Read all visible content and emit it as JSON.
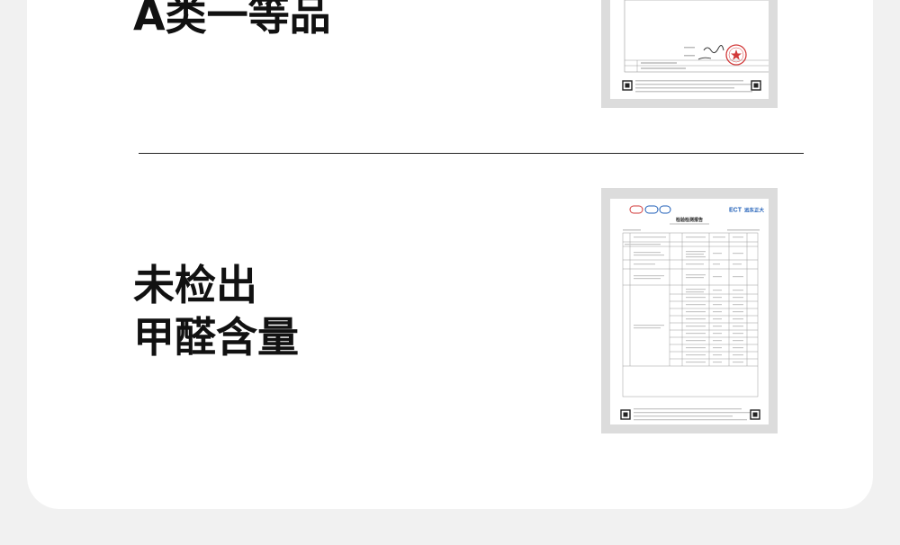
{
  "section_top": {
    "headline": "A类一等品"
  },
  "section_bottom": {
    "headline_line1": "未检出",
    "headline_line2": "甲醛含量"
  },
  "report": {
    "brand_logo": "ECT",
    "brand_name": "远东正大",
    "title": "检验检测报告"
  },
  "colors": {
    "background": "#f1f1f1",
    "card": "#ffffff",
    "text": "#111111",
    "brand_blue": "#1f5fb8",
    "seal_red": "#d23a3a"
  }
}
